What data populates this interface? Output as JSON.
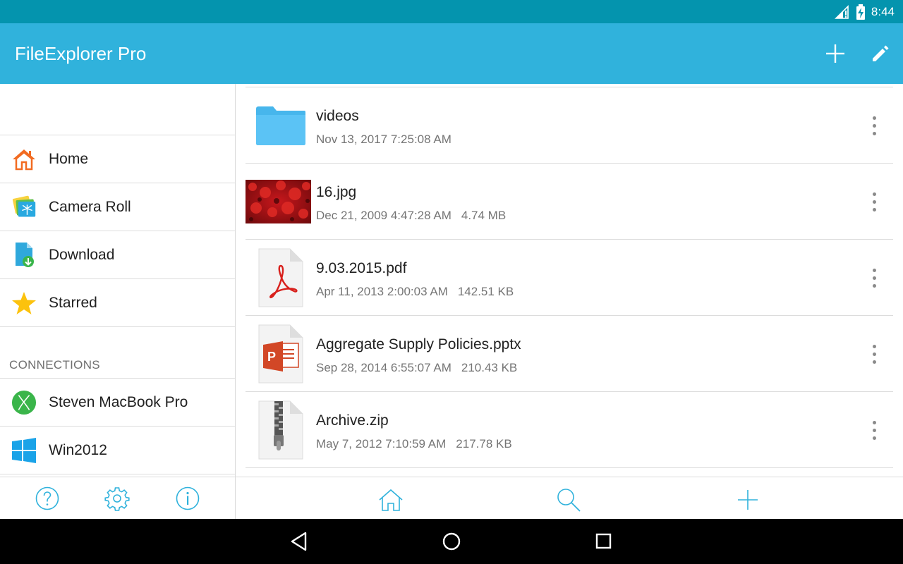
{
  "status_bar": {
    "time": "8:44",
    "icons": [
      "signal-icon",
      "battery-charging-icon"
    ]
  },
  "app_bar": {
    "title": "FileExplorer Pro",
    "actions": [
      "add-icon",
      "edit-pencil-icon"
    ]
  },
  "sidebar": {
    "items": [
      {
        "label": "Home",
        "icon": "home-icon"
      },
      {
        "label": "Camera Roll",
        "icon": "camera-roll-icon"
      },
      {
        "label": "Download",
        "icon": "download-icon"
      },
      {
        "label": "Starred",
        "icon": "star-icon"
      }
    ],
    "connections_header": "CONNECTIONS",
    "connections": [
      {
        "label": "Steven MacBook Pro",
        "icon": "mac-os-x-icon"
      },
      {
        "label": "Win2012",
        "icon": "windows-icon"
      }
    ],
    "footer": [
      "help-icon",
      "settings-icon",
      "info-icon"
    ]
  },
  "files": [
    {
      "name": "videos",
      "date": "Nov 13, 2017 7:25:08 AM",
      "size": "",
      "type": "folder"
    },
    {
      "name": "16.jpg",
      "date": "Dec 21, 2009 4:47:28 AM",
      "size": "4.74 MB",
      "type": "image"
    },
    {
      "name": "9.03.2015.pdf",
      "date": "Apr 11, 2013 2:00:03 AM",
      "size": "142.51 KB",
      "type": "pdf"
    },
    {
      "name": "Aggregate Supply Policies.pptx",
      "date": "Sep 28, 2014 6:55:07 AM",
      "size": "210.43 KB",
      "type": "pptx"
    },
    {
      "name": "Archive.zip",
      "date": "May 7, 2012 7:10:59 AM",
      "size": "217.78 KB",
      "type": "zip"
    }
  ],
  "bottom_bar": [
    "home-icon",
    "search-icon",
    "add-icon"
  ],
  "nav_bar": [
    "back-icon",
    "home-circle-icon",
    "recents-icon"
  ],
  "colors": {
    "status_bar": "#0494ae",
    "app_bar": "#30b2dc",
    "accent": "#30b2dc"
  }
}
